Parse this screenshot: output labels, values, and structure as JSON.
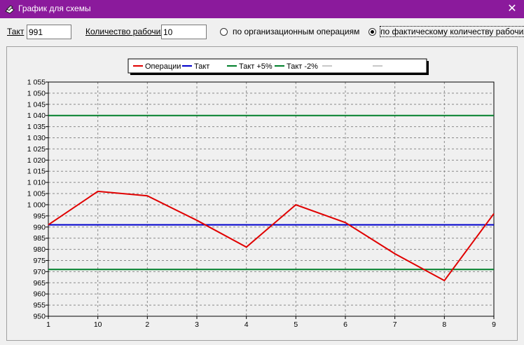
{
  "window": {
    "title": "График для схемы",
    "close_glyph": "✕",
    "icon": "app-window-icon"
  },
  "controls": {
    "takt_label": "Такт",
    "takt_value": "991",
    "workers_label": "Количество рабочих",
    "workers_value": "10",
    "mode_options": [
      {
        "label": "по организационным  операциям",
        "selected": false
      },
      {
        "label": "по фактическому количеству рабочих",
        "selected": true
      }
    ]
  },
  "colors": {
    "titlebar": "#8b1a9c",
    "operations": "#e00000",
    "takt": "#0000cc",
    "bounds": "#007f2a",
    "grid": "#8a8a8a"
  },
  "chart_data": {
    "type": "line",
    "legend_position": "top",
    "legend": [
      {
        "name": "Операции",
        "color": "#e00000"
      },
      {
        "name": "Такт",
        "color": "#0000cc"
      },
      {
        "name": "Такт +5%",
        "color": "#007f2a"
      },
      {
        "name": "Такт -2%",
        "color": "#007f2a"
      },
      {
        "name": "",
        "color": "#c8c8c8"
      },
      {
        "name": "",
        "color": "#c8c8c8"
      }
    ],
    "categories": [
      "1",
      "10",
      "2",
      "3",
      "4",
      "5",
      "6",
      "7",
      "8",
      "9"
    ],
    "series": [
      {
        "name": "Операции",
        "color": "#e00000",
        "values": [
          991,
          1006,
          1004,
          993,
          981,
          1000,
          992,
          978,
          966,
          996
        ]
      },
      {
        "name": "Такт",
        "color": "#0000cc",
        "values": [
          991,
          991,
          991,
          991,
          991,
          991,
          991,
          991,
          991,
          991
        ]
      },
      {
        "name": "Такт +5%",
        "color": "#007f2a",
        "values": [
          1040,
          1040,
          1040,
          1040,
          1040,
          1040,
          1040,
          1040,
          1040,
          1040
        ]
      },
      {
        "name": "Такт -2%",
        "color": "#007f2a",
        "values": [
          971,
          971,
          971,
          971,
          971,
          971,
          971,
          971,
          971,
          971
        ]
      }
    ],
    "ylim": [
      950,
      1055
    ],
    "ytick_step": 5,
    "ytick_labels": [
      "950",
      "955",
      "960",
      "965",
      "970",
      "975",
      "980",
      "985",
      "990",
      "995",
      "1 000",
      "1 005",
      "1 010",
      "1 015",
      "1 020",
      "1 025",
      "1 030",
      "1 035",
      "1 040",
      "1 045",
      "1 050",
      "1 055"
    ],
    "grid": true
  }
}
